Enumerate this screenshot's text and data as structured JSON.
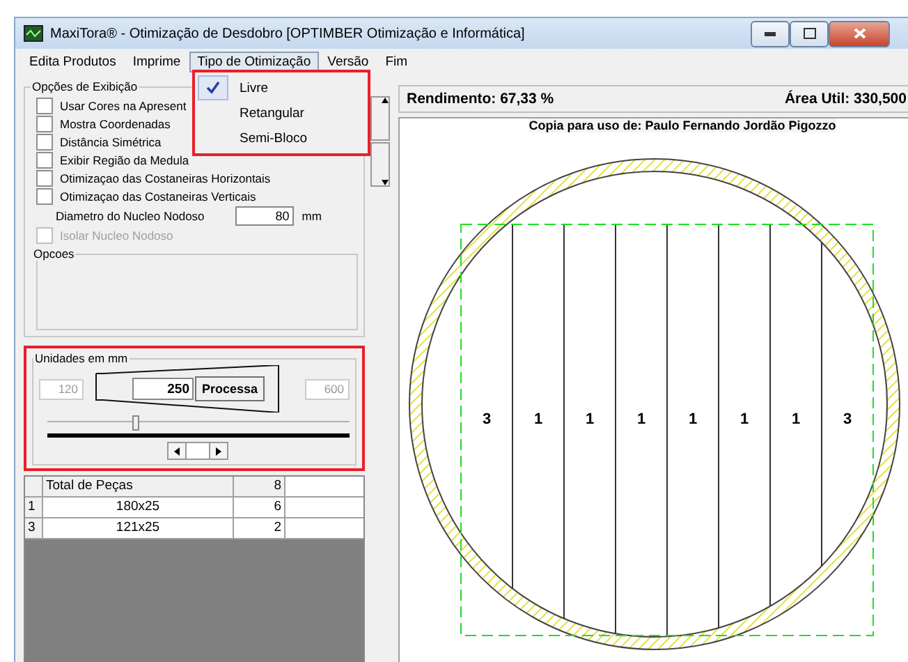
{
  "window": {
    "title": "MaxiTora® - Otimização de Desdobro   [OPTIMBER Otimização e Informática]"
  },
  "menu": [
    {
      "label": "Edita Produtos",
      "selected": false
    },
    {
      "label": "Imprime",
      "selected": false
    },
    {
      "label": "Tipo de Otimização",
      "selected": true
    },
    {
      "label": "Versão",
      "selected": false
    },
    {
      "label": "Fim",
      "selected": false
    }
  ],
  "dropdown": [
    {
      "label": "Livre",
      "checked": true
    },
    {
      "label": "Retangular",
      "checked": false
    },
    {
      "label": "Semi-Bloco",
      "checked": false
    }
  ],
  "display_options": {
    "title": "Opções de Exibição",
    "checkboxes": [
      {
        "label": "Usar Cores na Apresent",
        "checked": false,
        "disabled": false
      },
      {
        "label": "Mostra Coordenadas",
        "checked": false,
        "disabled": false
      },
      {
        "label": "Distância Simétrica",
        "checked": false,
        "disabled": false
      },
      {
        "label": "Exibir Região da Medula",
        "checked": false,
        "disabled": false
      },
      {
        "label": "Otimizaçao das Costaneiras Horizontais",
        "checked": false,
        "disabled": false
      },
      {
        "label": "Otimizaçao das Costaneiras Verticais",
        "checked": false,
        "disabled": false
      }
    ],
    "diameter": {
      "label": "Diametro do Nucleo Nodoso",
      "value": "80",
      "unit": "mm"
    },
    "isolate": {
      "label": "Isolar Nucleo Nodoso",
      "checked": false,
      "disabled": true
    },
    "options_group": {
      "title": "Opcoes"
    }
  },
  "units": {
    "title": "Unidades em mm",
    "min": "120",
    "value": "250",
    "button": "Processa",
    "max": "600",
    "level": 0.28
  },
  "table": {
    "header": {
      "label": "Total de Peças",
      "count": "8"
    },
    "rows": [
      {
        "index": "1",
        "label": "180x25",
        "count": "6"
      },
      {
        "index": "3",
        "label": "121x25",
        "count": "2"
      }
    ]
  },
  "stats": {
    "yield": "Rendimento:  67,33 %",
    "area": "Área Util:  330,500"
  },
  "license": "Copia para uso de: Paulo Fernando Jordão Pigozzo",
  "boards": [
    "3",
    "1",
    "1",
    "1",
    "1",
    "1",
    "1",
    "3"
  ]
}
